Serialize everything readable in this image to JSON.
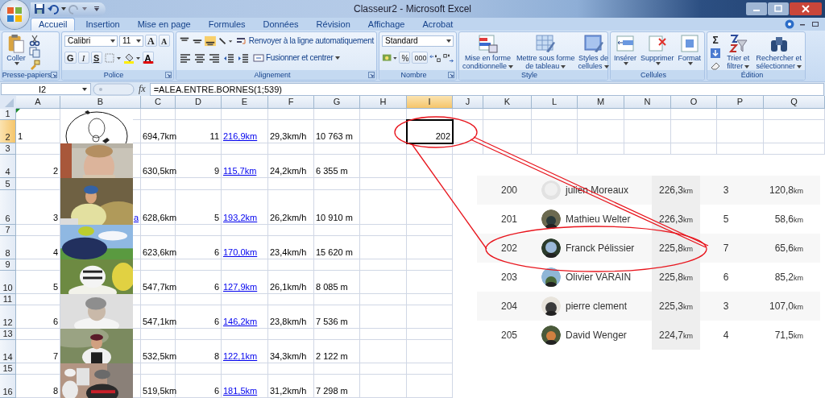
{
  "window": {
    "title": "Classeur2 - Microsoft Excel"
  },
  "tabs": [
    {
      "label": "Accueil",
      "selected": true
    },
    {
      "label": "Insertion",
      "selected": false
    },
    {
      "label": "Mise en page",
      "selected": false
    },
    {
      "label": "Formules",
      "selected": false
    },
    {
      "label": "Données",
      "selected": false
    },
    {
      "label": "Révision",
      "selected": false
    },
    {
      "label": "Affichage",
      "selected": false
    },
    {
      "label": "Acrobat",
      "selected": false
    }
  ],
  "ribbon": {
    "clipboard": {
      "label": "Presse-papiers",
      "paste": "Coller"
    },
    "font": {
      "label": "Police",
      "family": "Calibri",
      "size": "11",
      "grow": "A",
      "shrink": "A",
      "bold": "G",
      "italic": "I",
      "underline": "S",
      "font_color": "A"
    },
    "alignment": {
      "label": "Alignement",
      "wrap": "Renvoyer à la ligne automatiquement",
      "merge": "Fusionner et centrer"
    },
    "number": {
      "label": "Nombre",
      "format": "Standard",
      "percent": "%",
      "thousands": "000"
    },
    "styles": {
      "label": "Style",
      "buttons": [
        {
          "lines": [
            "Mise en forme",
            "conditionnelle"
          ]
        },
        {
          "lines": [
            "Mettre sous forme",
            "de tableau"
          ]
        },
        {
          "lines": [
            "Styles de",
            "cellules"
          ]
        }
      ]
    },
    "cells": {
      "label": "Cellules",
      "buttons": [
        "Insérer",
        "Supprimer",
        "Format"
      ]
    },
    "editing": {
      "label": "Édition",
      "sum": "Σ",
      "buttons": [
        {
          "lines": [
            "Trier et",
            "filtrer"
          ]
        },
        {
          "lines": [
            "Rechercher et",
            "sélectionner"
          ]
        }
      ]
    }
  },
  "formula_bar": {
    "name_box": "I2",
    "function_label": "fx",
    "formula": "=ALEA.ENTRE.BORNES(1;539)"
  },
  "sheet": {
    "columns": [
      {
        "label": "A",
        "selected": false
      },
      {
        "label": "B",
        "selected": false
      },
      {
        "label": "C",
        "selected": false
      },
      {
        "label": "D",
        "selected": false
      },
      {
        "label": "E",
        "selected": false
      },
      {
        "label": "F",
        "selected": false
      },
      {
        "label": "G",
        "selected": false
      },
      {
        "label": "H",
        "selected": false
      },
      {
        "label": "I",
        "selected": true
      },
      {
        "label": "J",
        "selected": false
      },
      {
        "label": "K",
        "selected": false
      },
      {
        "label": "L",
        "selected": false
      },
      {
        "label": "M",
        "selected": false
      },
      {
        "label": "N",
        "selected": false
      },
      {
        "label": "O",
        "selected": false
      },
      {
        "label": "P",
        "selected": false
      },
      {
        "label": "Q",
        "selected": false
      }
    ],
    "rows": [
      {
        "label": "1",
        "selected": false
      },
      {
        "label": "2",
        "selected": true
      },
      {
        "label": "3",
        "selected": false
      },
      {
        "label": "4",
        "selected": false
      },
      {
        "label": "5",
        "selected": false
      },
      {
        "label": "6",
        "selected": false
      },
      {
        "label": "7",
        "selected": false
      },
      {
        "label": "8",
        "selected": false
      },
      {
        "label": "9",
        "selected": false
      },
      {
        "label": "10",
        "selected": false
      },
      {
        "label": "11",
        "selected": false
      },
      {
        "label": "12",
        "selected": false
      },
      {
        "label": "13",
        "selected": false
      },
      {
        "label": "14",
        "selected": false
      },
      {
        "label": "15",
        "selected": false
      },
      {
        "label": "16",
        "selected": false
      }
    ],
    "records": [
      {
        "rank": {
          "value": "1",
          "kind": "text"
        },
        "kind": "logo",
        "distance": "694,7km",
        "count": "11",
        "link": "216,9km",
        "speed": "29,3km/h",
        "elevation": "10 763 m",
        "column_i": {
          "value": "202",
          "selected": true
        }
      },
      {
        "rank": {
          "value": "2",
          "kind": "number"
        },
        "distance": "630,5km",
        "count": "9",
        "link": "115,7km",
        "speed": "24,2km/h",
        "elevation": "6 355 m"
      },
      {
        "rank": {
          "value": "3",
          "kind": "number"
        },
        "name_fragment": "a",
        "distance": "628,6km",
        "count": "5",
        "link": "193,2km",
        "speed": "26,2km/h",
        "elevation": "10 910 m"
      },
      {
        "rank": {
          "value": "4",
          "kind": "number"
        },
        "distance": "623,6km",
        "count": "6",
        "link": "170,0km",
        "speed": "23,4km/h",
        "elevation": "15 620 m"
      },
      {
        "rank": {
          "value": "5",
          "kind": "number"
        },
        "distance": "547,7km",
        "count": "6",
        "link": "127,9km",
        "speed": "26,1km/h",
        "elevation": "8 085 m"
      },
      {
        "rank": {
          "value": "6",
          "kind": "number"
        },
        "distance": "547,1km",
        "count": "6",
        "link": "146,2km",
        "speed": "23,8km/h",
        "elevation": "7 536 m"
      },
      {
        "rank": {
          "value": "7",
          "kind": "number"
        },
        "distance": "532,5km",
        "count": "8",
        "link": "122,1km",
        "speed": "34,3km/h",
        "elevation": "2 122 m"
      },
      {
        "rank": {
          "value": "8",
          "kind": "number"
        },
        "distance": "519,5km",
        "count": "6",
        "link": "181,5km",
        "speed": "31,2km/h",
        "elevation": "7 298 m"
      }
    ]
  },
  "ranking": [
    {
      "rank": "200",
      "kind": "placeholder",
      "name": "julien Moreaux",
      "distance": "226,3",
      "distance_unit": "km",
      "count": "3",
      "km": "120,8",
      "km_unit": "km"
    },
    {
      "rank": "201",
      "name": "Mathieu Welter",
      "distance": "226,3",
      "distance_unit": "km",
      "count": "5",
      "km": "58,6",
      "km_unit": "km"
    },
    {
      "rank": "202",
      "name": "Franck Pélissier",
      "distance": "225,8",
      "distance_unit": "km",
      "count": "7",
      "km": "65,6",
      "km_unit": "km"
    },
    {
      "rank": "203",
      "name": "Olivier VARAIN",
      "distance": "225,8",
      "distance_unit": "km",
      "count": "6",
      "km": "85,2",
      "km_unit": "km"
    },
    {
      "rank": "204",
      "name": "pierre clement",
      "distance": "225,3",
      "distance_unit": "km",
      "count": "3",
      "km": "107,0",
      "km_unit": "km"
    },
    {
      "rank": "205",
      "name": "David Wenger",
      "distance": "224,7",
      "distance_unit": "km",
      "count": "4",
      "km": "71,5",
      "km_unit": "km"
    }
  ]
}
